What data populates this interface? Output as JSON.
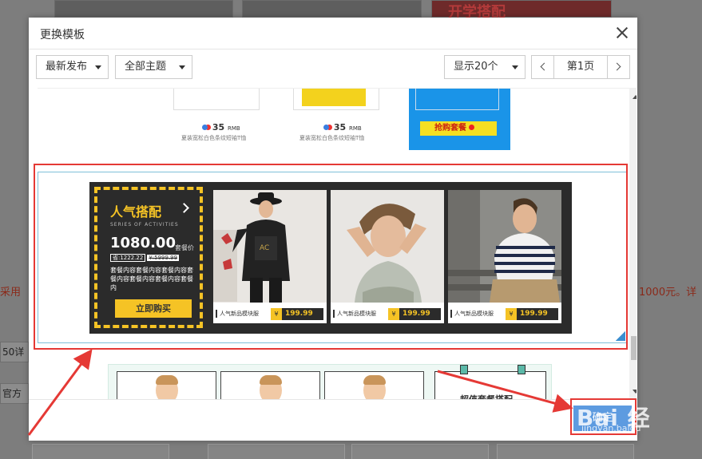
{
  "background": {
    "thumb3_text": "开学搭配",
    "left_notice": "采用",
    "right_notice": "1000元。详",
    "chip1": "50详",
    "chip2": "官方"
  },
  "modal": {
    "title": "更换模板",
    "filters": {
      "sort": "最新发布",
      "theme": "全部主题",
      "page_size": "显示20个"
    },
    "pager": {
      "page_label": "第1页"
    },
    "footer": {
      "confirm_label": "确定"
    }
  },
  "templates": {
    "item1": {
      "price1": "35",
      "unit1": "RMB",
      "price2": "35",
      "unit2": "RMB",
      "caption": "夏装宽松白色条纹短袖T恤",
      "buy_label": "抢购套餐"
    },
    "item2": {
      "title": "人气搭配",
      "subtitle": "SERIES OF ACTIVITIES",
      "price": "1080.00",
      "price_unit": "套餐价",
      "save": "省:1222.22",
      "original": "¥:5999.99",
      "description": "套餐内容套餐内容套餐内容套餐内容套餐内容套餐内容套餐内",
      "buy_label": "立即购买",
      "products": [
        {
          "name": "人气新品模块服",
          "currency": "¥",
          "price": "199.99"
        },
        {
          "name": "人气新品模块服",
          "currency": "¥",
          "price": "199.99"
        },
        {
          "name": "人气新品模块服",
          "currency": "¥",
          "price": "199.99"
        }
      ]
    },
    "item3": {
      "title": "超值套餐搭配"
    }
  },
  "colors": {
    "highlight": "#e53935",
    "accent_yellow": "#f5c325",
    "confirm_blue": "#5d9be0"
  }
}
